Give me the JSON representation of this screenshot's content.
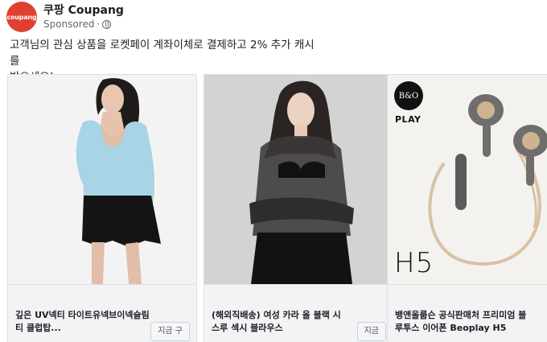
{
  "post": {
    "page_name": "쿠팡 Coupang",
    "avatar_text": "coupang",
    "sponsored": "Sponsored",
    "dot": "·",
    "body_line1": "고객님의 관심 상품을 로켓페이 계좌이체로 결제하고 2% 추가 캐시를",
    "body_line2": "받으세요!"
  },
  "carousel": {
    "cards": [
      {
        "title": "깊은 UV넥티 타이트유넥브이넥슬림티 클럽탑...",
        "cta": "지금 구",
        "image": "woman-light-blue-top-black-skirt"
      },
      {
        "title": "(해외직배송) 여성 카라 올 블랙 시스루 섹시 블라우스",
        "cta": "지금",
        "image": "woman-black-sheer-blouse"
      },
      {
        "title": "뱅앤올룹슨 공식판매처 프리미엄 블루투스 이어폰 Beoplay H5",
        "cta": "지",
        "image": "beoplay-h5-earphones",
        "logo_text": "B&O",
        "brand_sub": "PLAY",
        "product_label": "H5"
      }
    ]
  },
  "colors": {
    "brand_red": "#e0402f",
    "card_bg": "#f2f3f5"
  }
}
